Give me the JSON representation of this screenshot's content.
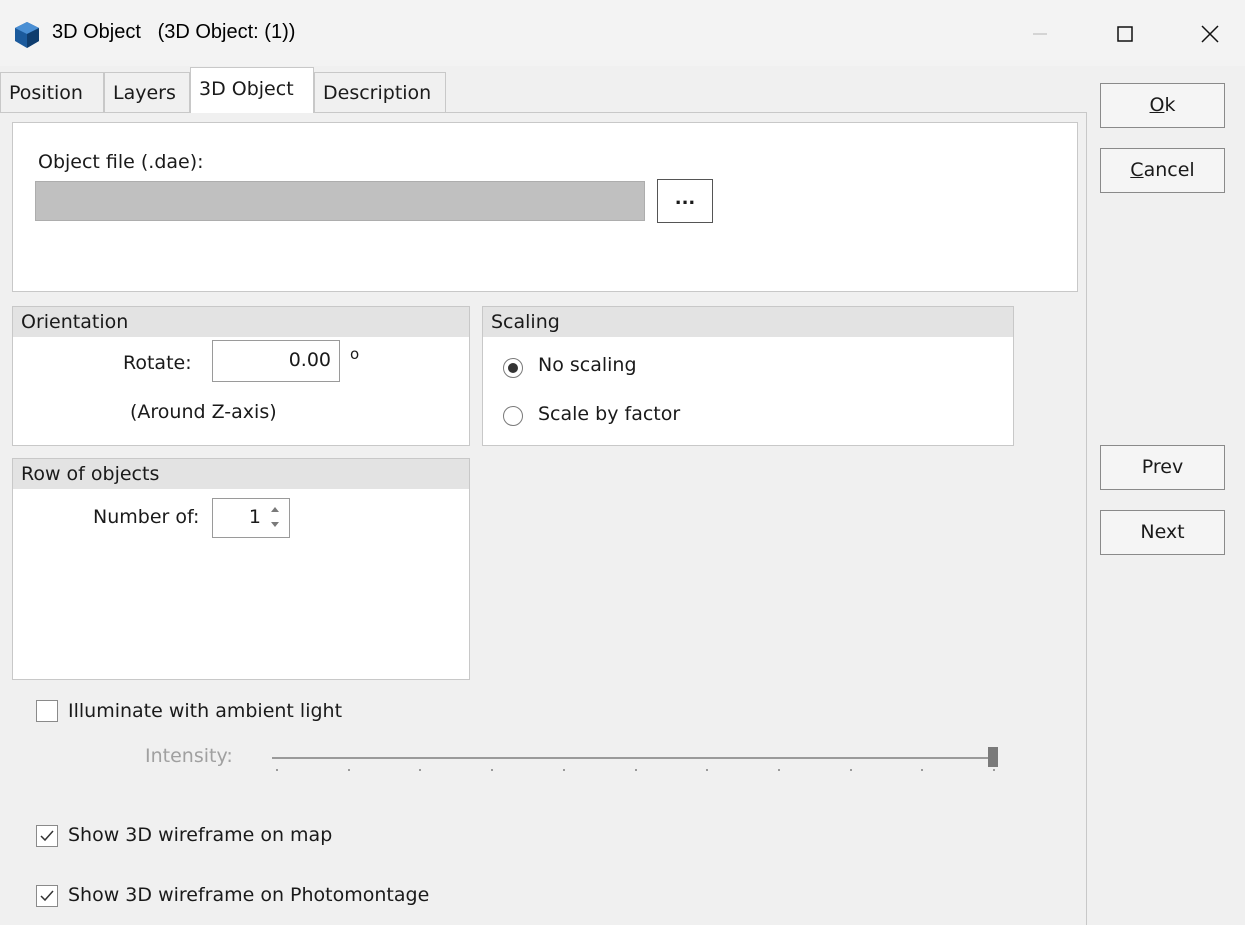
{
  "window": {
    "title": "3D Object   (3D Object: (1))",
    "icon": "app-3d-object-icon",
    "controls": [
      "minimize-icon",
      "maximize-icon",
      "close-icon"
    ]
  },
  "tabs": [
    {
      "label": "Position",
      "active": false
    },
    {
      "label": "Layers",
      "active": false
    },
    {
      "label": "3D Object",
      "active": true
    },
    {
      "label": "Description",
      "active": false
    }
  ],
  "object_file": {
    "label": "Object file (.dae):",
    "value": "",
    "browse_label": "..."
  },
  "orientation": {
    "header": "Orientation",
    "rotate_label": "Rotate:",
    "rotate_value": "0.00",
    "unit": "o",
    "note": "(Around Z-axis)"
  },
  "scaling": {
    "header": "Scaling",
    "options": [
      {
        "label": "No scaling",
        "selected": true
      },
      {
        "label": "Scale by factor",
        "selected": false
      }
    ]
  },
  "row_of_objects": {
    "header": "Row of objects",
    "number_label": "Number of:",
    "number_value": "1"
  },
  "ambient": {
    "label": "Illuminate with ambient light",
    "checked": false,
    "intensity_label": "Intensity:",
    "intensity_fraction": 1.0
  },
  "wireframe": [
    {
      "label": "Show 3D wireframe on map",
      "checked": true
    },
    {
      "label": "Show 3D wireframe on Photomontage",
      "checked": true
    }
  ],
  "buttons": {
    "ok_access": "O",
    "ok_rest": "k",
    "cancel_access": "C",
    "cancel_rest": "ancel",
    "prev": "Prev",
    "next": "Next"
  },
  "colors": {
    "accent_icon": "#1b5a9c",
    "group_header": "#e3e3e3",
    "disabled_text": "#a0a0a0"
  }
}
